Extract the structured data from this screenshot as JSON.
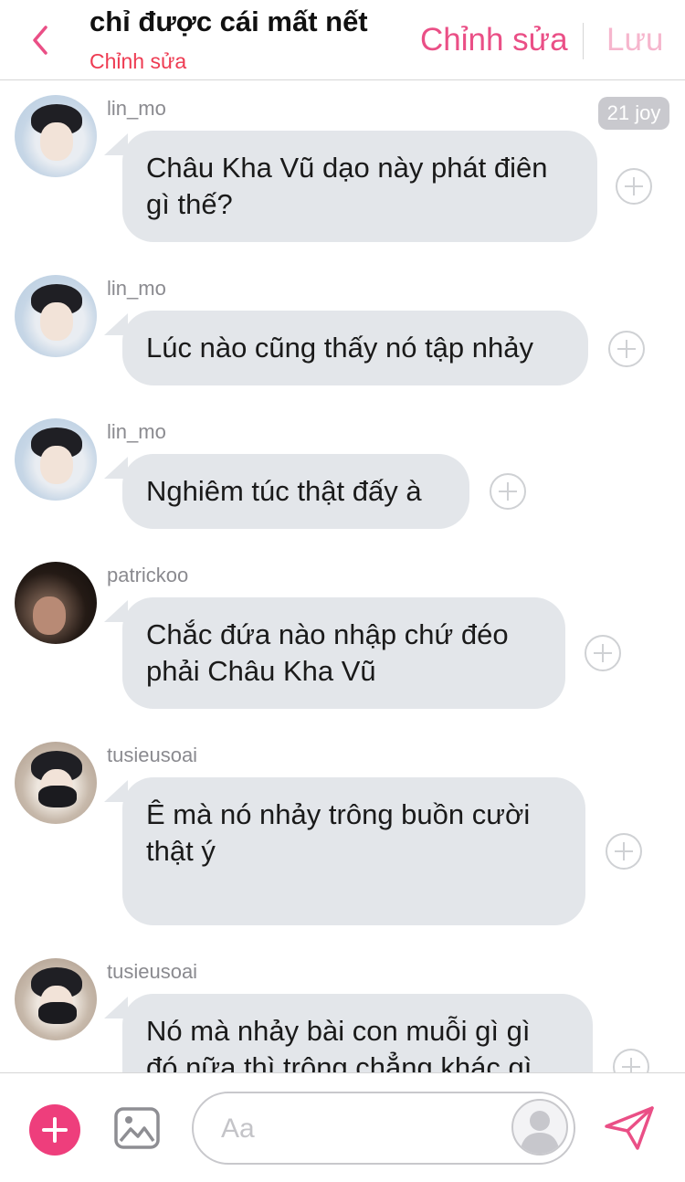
{
  "header": {
    "title": "chỉ được cái mất nết",
    "subtitle": "Chỉnh sửa",
    "edit_label": "Chỉnh sửa",
    "save_label": "Lưu"
  },
  "messages": [
    {
      "user": "lin_mo",
      "text": "Châu Kha Vũ dạo này phát điên gì thế?",
      "badge": "21 joy"
    },
    {
      "user": "lin_mo",
      "text": "Lúc nào cũng thấy nó tập nhảy"
    },
    {
      "user": "lin_mo",
      "text": "Nghiêm túc thật đấy à"
    },
    {
      "user": "patrickoo",
      "text": "Chắc đứa nào nhập chứ đéo phải Châu Kha Vũ"
    },
    {
      "user": "tusieusoai",
      "text": "Ê mà nó nhảy trông buồn cười thật ý"
    },
    {
      "user": "tusieusoai",
      "text": "Nó mà nhảy bài con muỗi gì gì đó nữa thì trông chẳng khác gì"
    }
  ],
  "composer": {
    "placeholder": "Aa"
  },
  "colors": {
    "accent": "#ea4f86",
    "add_button": "#ee3e7c",
    "subtitle": "#ee3b52",
    "bubble": "#e3e6ea"
  },
  "icons": {
    "back": "chevron-left-icon",
    "add": "plus-icon",
    "image": "image-icon",
    "persona": "person-icon",
    "send": "paper-plane-icon",
    "react": "plus-circle-icon"
  }
}
